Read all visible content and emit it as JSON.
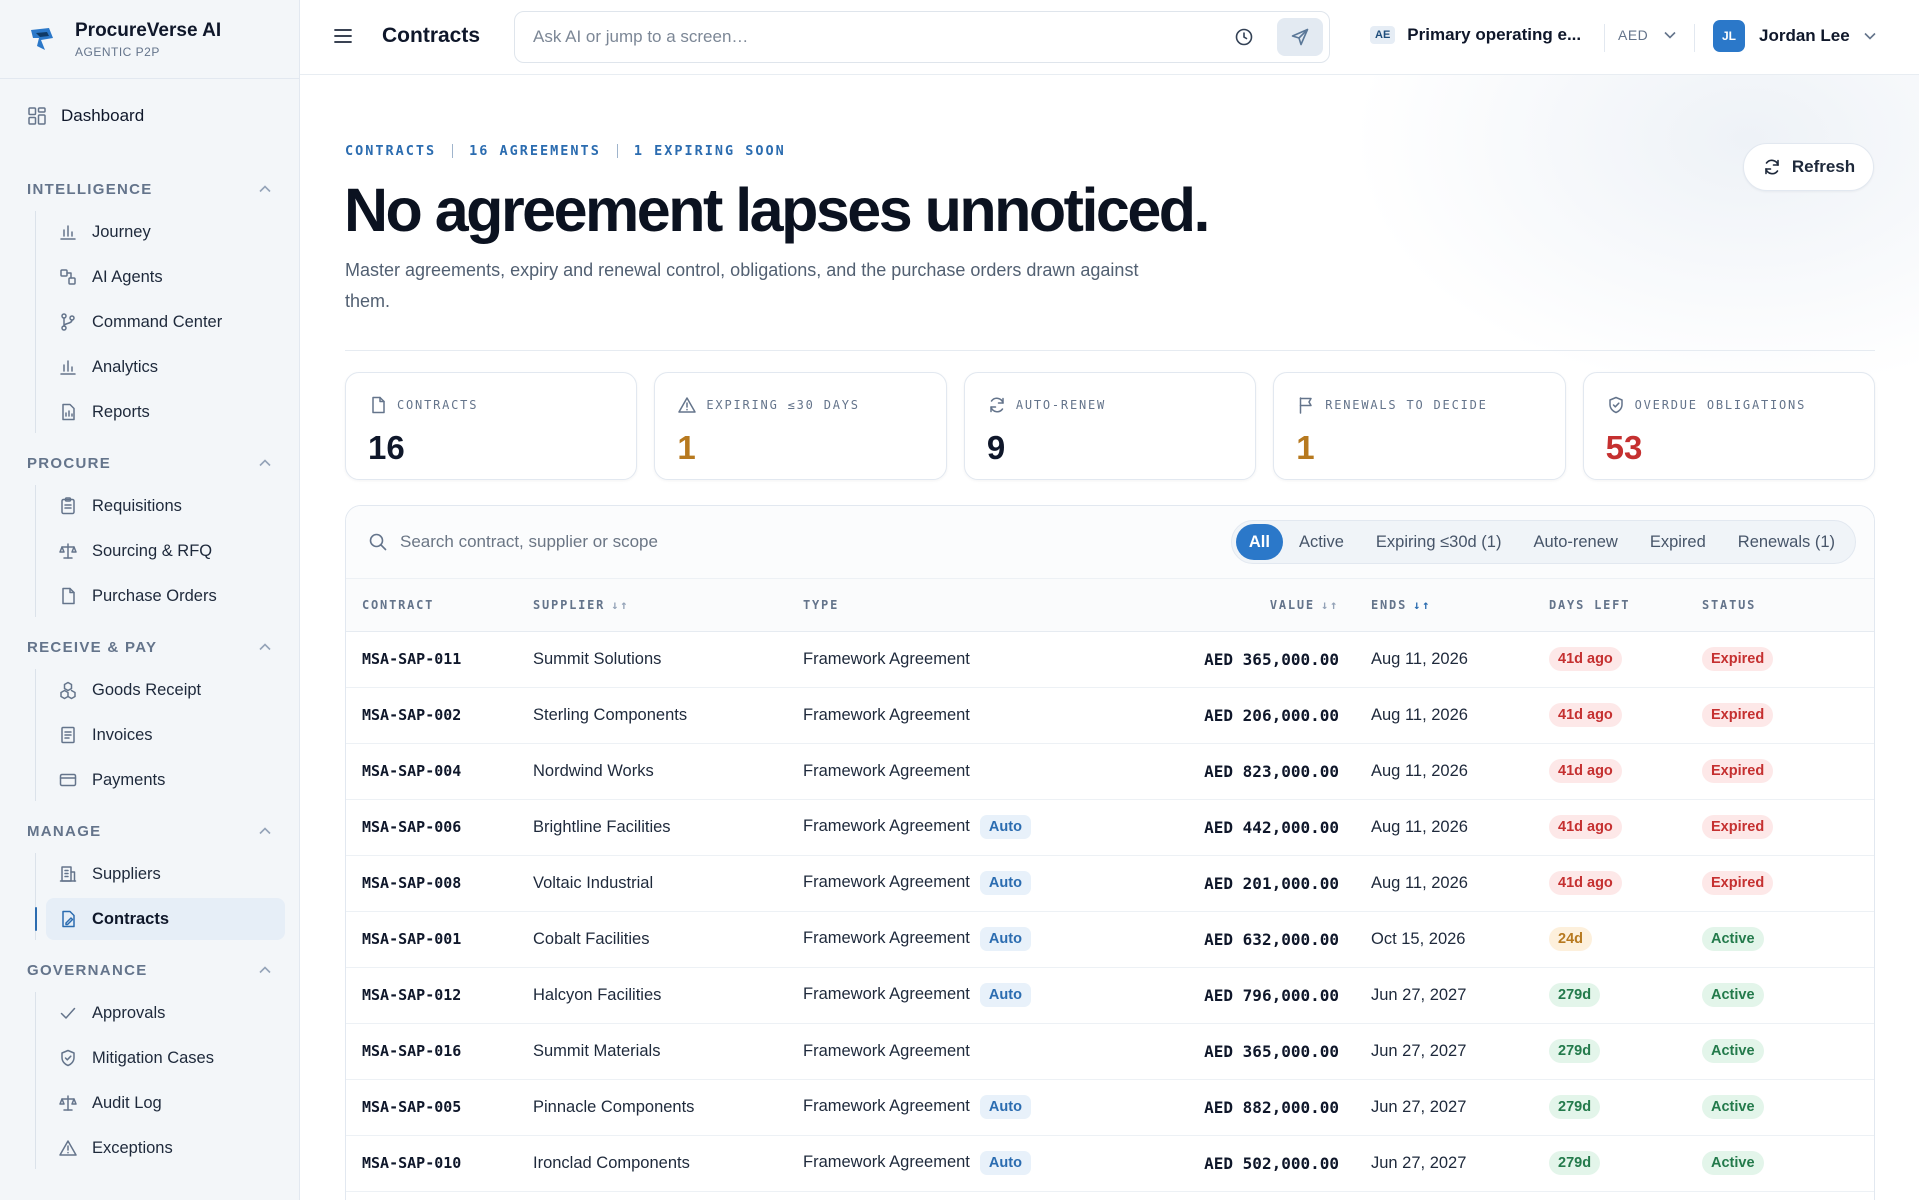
{
  "brand": {
    "name": "ProcureVerse AI",
    "subtitle": "AGENTIC P2P"
  },
  "sidebar": {
    "dashboard": {
      "label": "Dashboard",
      "icon": "grid-icon"
    },
    "sections": [
      {
        "title": "INTELLIGENCE",
        "items": [
          {
            "label": "Journey",
            "icon": "bar-chart-icon"
          },
          {
            "label": "AI Agents",
            "icon": "agents-icon"
          },
          {
            "label": "Command Center",
            "icon": "branch-icon"
          },
          {
            "label": "Analytics",
            "icon": "bar-chart-icon"
          },
          {
            "label": "Reports",
            "icon": "report-icon"
          }
        ]
      },
      {
        "title": "PROCURE",
        "items": [
          {
            "label": "Requisitions",
            "icon": "clipboard-icon"
          },
          {
            "label": "Sourcing & RFQ",
            "icon": "scale-icon"
          },
          {
            "label": "Purchase Orders",
            "icon": "document-icon"
          }
        ]
      },
      {
        "title": "RECEIVE & PAY",
        "items": [
          {
            "label": "Goods Receipt",
            "icon": "boxes-icon"
          },
          {
            "label": "Invoices",
            "icon": "invoice-icon"
          },
          {
            "label": "Payments",
            "icon": "card-icon"
          }
        ]
      },
      {
        "title": "MANAGE",
        "items": [
          {
            "label": "Suppliers",
            "icon": "building-icon"
          },
          {
            "label": "Contracts",
            "icon": "contract-icon",
            "active": true
          }
        ]
      },
      {
        "title": "GOVERNANCE",
        "items": [
          {
            "label": "Approvals",
            "icon": "check-icon"
          },
          {
            "label": "Mitigation Cases",
            "icon": "shield-icon"
          },
          {
            "label": "Audit Log",
            "icon": "scale-icon"
          },
          {
            "label": "Exceptions",
            "icon": "warning-icon"
          }
        ]
      }
    ]
  },
  "topbar": {
    "title": "Contracts",
    "search_placeholder": "Ask AI or jump to a screen…",
    "entity_badge": "AE",
    "entity_name": "Primary operating e...",
    "currency": "AED",
    "user_initials": "JL",
    "user_name": "Jordan Lee"
  },
  "hero": {
    "eyebrow": [
      "CONTRACTS",
      "16 AGREEMENTS",
      "1 EXPIRING SOON"
    ],
    "headline": "No agreement lapses unnoticed.",
    "subtext": "Master agreements, expiry and renewal control, obligations, and the purchase orders drawn against them.",
    "refresh_label": "Refresh"
  },
  "kpis": [
    {
      "label": "CONTRACTS",
      "value": "16",
      "icon": "document-icon",
      "tone": "default"
    },
    {
      "label": "EXPIRING ≤30 DAYS",
      "value": "1",
      "icon": "warning-icon",
      "tone": "amber"
    },
    {
      "label": "AUTO-RENEW",
      "value": "9",
      "icon": "refresh-icon",
      "tone": "default"
    },
    {
      "label": "RENEWALS TO DECIDE",
      "value": "1",
      "icon": "flag-icon",
      "tone": "amber"
    },
    {
      "label": "OVERDUE OBLIGATIONS",
      "value": "53",
      "icon": "shield-icon",
      "tone": "red"
    }
  ],
  "table": {
    "search_placeholder": "Search contract, supplier or scope",
    "filters": [
      {
        "label": "All",
        "active": true
      },
      {
        "label": "Active"
      },
      {
        "label": "Expiring ≤30d (1)"
      },
      {
        "label": "Auto-renew"
      },
      {
        "label": "Expired"
      },
      {
        "label": "Renewals (1)"
      }
    ],
    "columns": [
      "CONTRACT",
      "SUPPLIER",
      "TYPE",
      "VALUE",
      "ENDS",
      "DAYS LEFT",
      "STATUS"
    ],
    "auto_label": "Auto",
    "rows": [
      {
        "id": "MSA-SAP-011",
        "supplier": "Summit Solutions",
        "type": "Framework Agreement",
        "auto": false,
        "value": "AED 365,000.00",
        "ends": "Aug 11, 2026",
        "days": "41d ago",
        "days_tone": "red",
        "status": "Expired",
        "status_tone": "red"
      },
      {
        "id": "MSA-SAP-002",
        "supplier": "Sterling Components",
        "type": "Framework Agreement",
        "auto": false,
        "value": "AED 206,000.00",
        "ends": "Aug 11, 2026",
        "days": "41d ago",
        "days_tone": "red",
        "status": "Expired",
        "status_tone": "red"
      },
      {
        "id": "MSA-SAP-004",
        "supplier": "Nordwind Works",
        "type": "Framework Agreement",
        "auto": false,
        "value": "AED 823,000.00",
        "ends": "Aug 11, 2026",
        "days": "41d ago",
        "days_tone": "red",
        "status": "Expired",
        "status_tone": "red"
      },
      {
        "id": "MSA-SAP-006",
        "supplier": "Brightline Facilities",
        "type": "Framework Agreement",
        "auto": true,
        "value": "AED 442,000.00",
        "ends": "Aug 11, 2026",
        "days": "41d ago",
        "days_tone": "red",
        "status": "Expired",
        "status_tone": "red"
      },
      {
        "id": "MSA-SAP-008",
        "supplier": "Voltaic Industrial",
        "type": "Framework Agreement",
        "auto": true,
        "value": "AED 201,000.00",
        "ends": "Aug 11, 2026",
        "days": "41d ago",
        "days_tone": "red",
        "status": "Expired",
        "status_tone": "red"
      },
      {
        "id": "MSA-SAP-001",
        "supplier": "Cobalt Facilities",
        "type": "Framework Agreement",
        "auto": true,
        "value": "AED 632,000.00",
        "ends": "Oct 15, 2026",
        "days": "24d",
        "days_tone": "amber",
        "status": "Active",
        "status_tone": "green"
      },
      {
        "id": "MSA-SAP-012",
        "supplier": "Halcyon Facilities",
        "type": "Framework Agreement",
        "auto": true,
        "value": "AED 796,000.00",
        "ends": "Jun 27, 2027",
        "days": "279d",
        "days_tone": "green",
        "status": "Active",
        "status_tone": "green"
      },
      {
        "id": "MSA-SAP-016",
        "supplier": "Summit Materials",
        "type": "Framework Agreement",
        "auto": false,
        "value": "AED 365,000.00",
        "ends": "Jun 27, 2027",
        "days": "279d",
        "days_tone": "green",
        "status": "Active",
        "status_tone": "green"
      },
      {
        "id": "MSA-SAP-005",
        "supplier": "Pinnacle Components",
        "type": "Framework Agreement",
        "auto": true,
        "value": "AED 882,000.00",
        "ends": "Jun 27, 2027",
        "days": "279d",
        "days_tone": "green",
        "status": "Active",
        "status_tone": "green"
      },
      {
        "id": "MSA-SAP-010",
        "supplier": "Ironclad Components",
        "type": "Framework Agreement",
        "auto": true,
        "value": "AED 502,000.00",
        "ends": "Jun 27, 2027",
        "days": "279d",
        "days_tone": "green",
        "status": "Active",
        "status_tone": "green"
      }
    ]
  },
  "colors": {
    "accent": "#2b78c9",
    "amber": "#b7791f",
    "red": "#c53030",
    "green": "#237a4b"
  }
}
